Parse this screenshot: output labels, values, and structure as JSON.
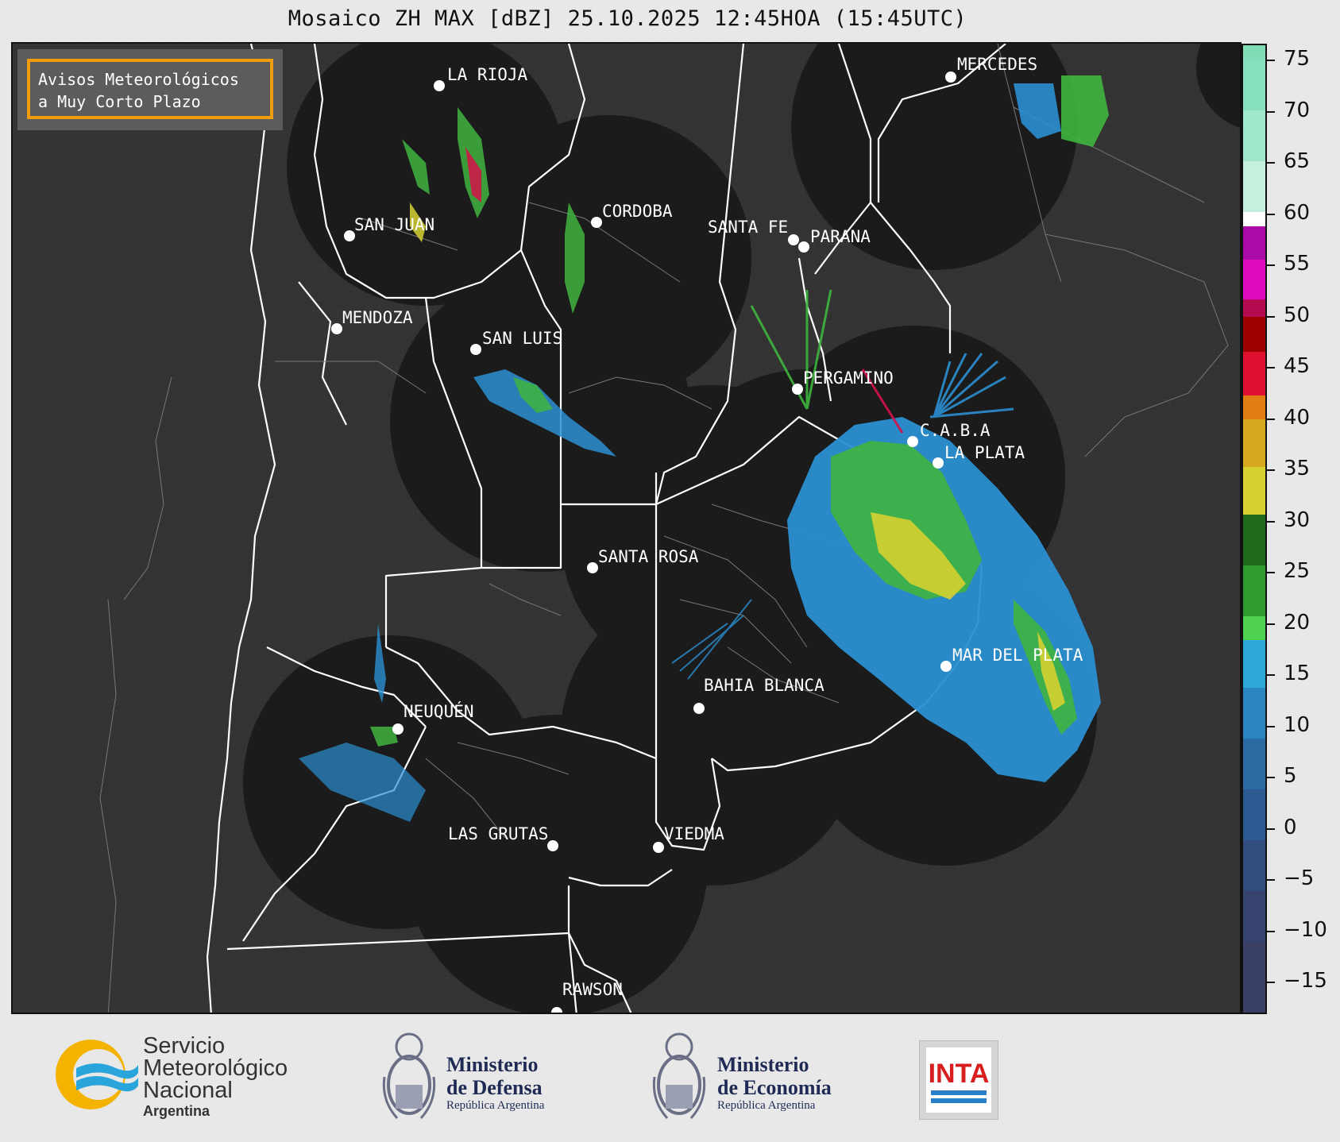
{
  "title": "Mosaico ZH MAX [dBZ] 25.10.2025 12:45HOA (15:45UTC)",
  "notice": {
    "line1": "Avisos Meteorológicos",
    "line2": "a Muy Corto Plazo"
  },
  "cities": [
    {
      "name": "LA RIOJA"
    },
    {
      "name": "SAN JUAN"
    },
    {
      "name": "CORDOBA"
    },
    {
      "name": "SANTA FE"
    },
    {
      "name": "PARANA"
    },
    {
      "name": "MERCEDES"
    },
    {
      "name": "MENDOZA"
    },
    {
      "name": "SAN LUIS"
    },
    {
      "name": "PERGAMINO"
    },
    {
      "name": "C.A.B.A"
    },
    {
      "name": "LA PLATA"
    },
    {
      "name": "SANTA ROSA"
    },
    {
      "name": "MAR DEL PLATA"
    },
    {
      "name": "BAHIA BLANCA"
    },
    {
      "name": "NEUQUÉN"
    },
    {
      "name": "LAS GRUTAS"
    },
    {
      "name": "VIEDMA"
    },
    {
      "name": "RAWSON"
    }
  ],
  "colorbar": {
    "unit": "dBZ",
    "ticks": [
      "75",
      "70",
      "65",
      "60",
      "55",
      "50",
      "45",
      "40",
      "35",
      "30",
      "25",
      "20",
      "15",
      "10",
      "5",
      "0",
      "−5",
      "−10",
      "−15"
    ],
    "range": [
      -18.5,
      76.5
    ]
  },
  "logos": {
    "smn_line1": "Servicio",
    "smn_line2": "Meteorológico",
    "smn_line3": "Nacional",
    "smn_line4": "Argentina",
    "defensa_line1": "Ministerio",
    "defensa_line2": "de Defensa",
    "defensa_line3": "República Argentina",
    "economia_line1": "Ministerio",
    "economia_line2": "de Economía",
    "economia_line3": "República Argentina",
    "inta": "INTA"
  },
  "colors": {
    "ocean_land": "#333333",
    "radar_coverage": "#1b1b1b",
    "borders": "#ffffff",
    "notice_border": "#f29d0f"
  }
}
